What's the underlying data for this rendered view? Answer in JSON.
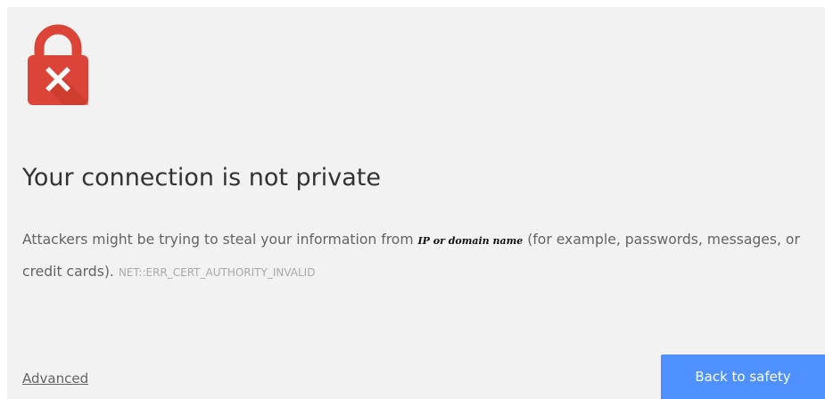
{
  "page": {
    "title": "Your connection is not private",
    "body": {
      "before_domain": "Attackers might be trying to steal your information from ",
      "domain_placeholder": "IP or domain name",
      "after_domain": " (for example, passwords, messages, or credit cards). ",
      "error_code": "NET::ERR_CERT_AUTHORITY_INVALID"
    },
    "advanced_label": "Advanced",
    "back_button_label": "Back to safety"
  },
  "icons": {
    "lock": "lock-error-icon"
  },
  "colors": {
    "background": "#f2f2f2",
    "lock_red": "#db4437",
    "button_blue": "#4d90fe",
    "title_text": "#333333",
    "body_text": "#646464",
    "error_code_text": "#a9a9a9"
  }
}
